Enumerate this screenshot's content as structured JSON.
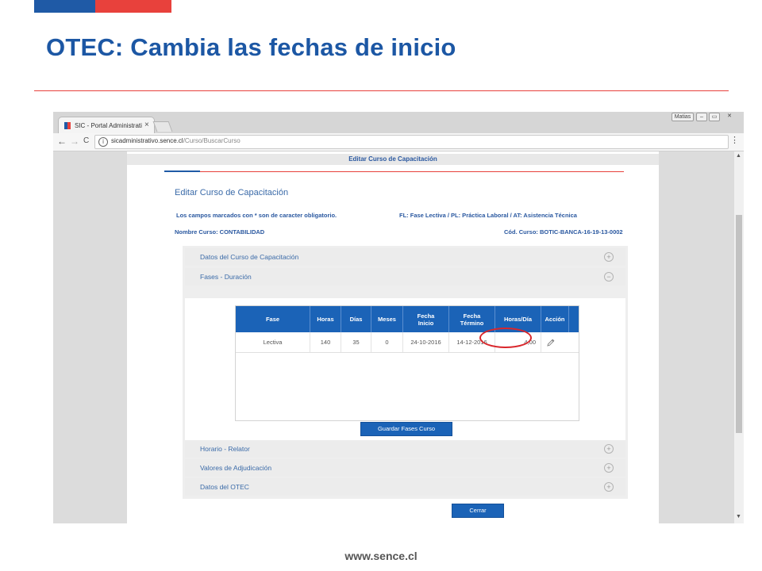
{
  "slide": {
    "title": "OTEC: Cambia las fechas de inicio",
    "footer": "www.sence.cl"
  },
  "browser": {
    "tab_title": "SIC - Portal Administrati",
    "tab_close": "×",
    "window_user_label": "Matias",
    "window_min": "–",
    "window_restore": "▭",
    "window_close": "✕",
    "url_host": "sicadministrativo.sence.cl",
    "url_path": "/Curso/BuscarCurso",
    "back": "←",
    "forward": "→",
    "reload": "C",
    "star": "☆",
    "menu": "⋮"
  },
  "page": {
    "modal_header": "Editar Curso de Capacitación",
    "form_title": "Editar Curso de Capacitación",
    "required_note": "Los campos marcados con * son de caracter obligatorio.",
    "phase_legend": "FL: Fase Lectiva / PL: Práctica Laboral / AT: Asistencia Técnica",
    "course_name": "Nombre Curso: CONTABILIDAD",
    "course_code": "Cód. Curso: BOTIC-BANCA-16-19-13-0002"
  },
  "accordion": {
    "sections": [
      {
        "label": "Datos del Curso de Capacitación",
        "toggle": "+"
      },
      {
        "label": "Fases - Duración",
        "toggle": "−"
      },
      {
        "label": "Horario - Relator",
        "toggle": "+"
      },
      {
        "label": "Valores de Adjudicación",
        "toggle": "+"
      },
      {
        "label": "Datos del OTEC",
        "toggle": "+"
      }
    ]
  },
  "phases_table": {
    "headers": [
      "Fase",
      "Horas",
      "Días",
      "Meses",
      "Fecha\nInicio",
      "Fecha\nTérmino",
      "Horas/Día",
      "Acción"
    ],
    "rows": [
      [
        "Lectiva",
        "140",
        "35",
        "0",
        "24-10-2016",
        "14-12-2016",
        "4,00"
      ]
    ]
  },
  "buttons": {
    "save_phases": "Guardar Fases Curso",
    "close": "Cerrar"
  },
  "colors": {
    "brand_blue": "#1c57a4",
    "brand_red": "#e8413c",
    "table_header": "#1b63b7",
    "annotation_circle": "#d9262b"
  },
  "icons": {
    "edit": "pencil-icon",
    "expand": "plus-circle-icon",
    "collapse": "minus-circle-icon"
  }
}
